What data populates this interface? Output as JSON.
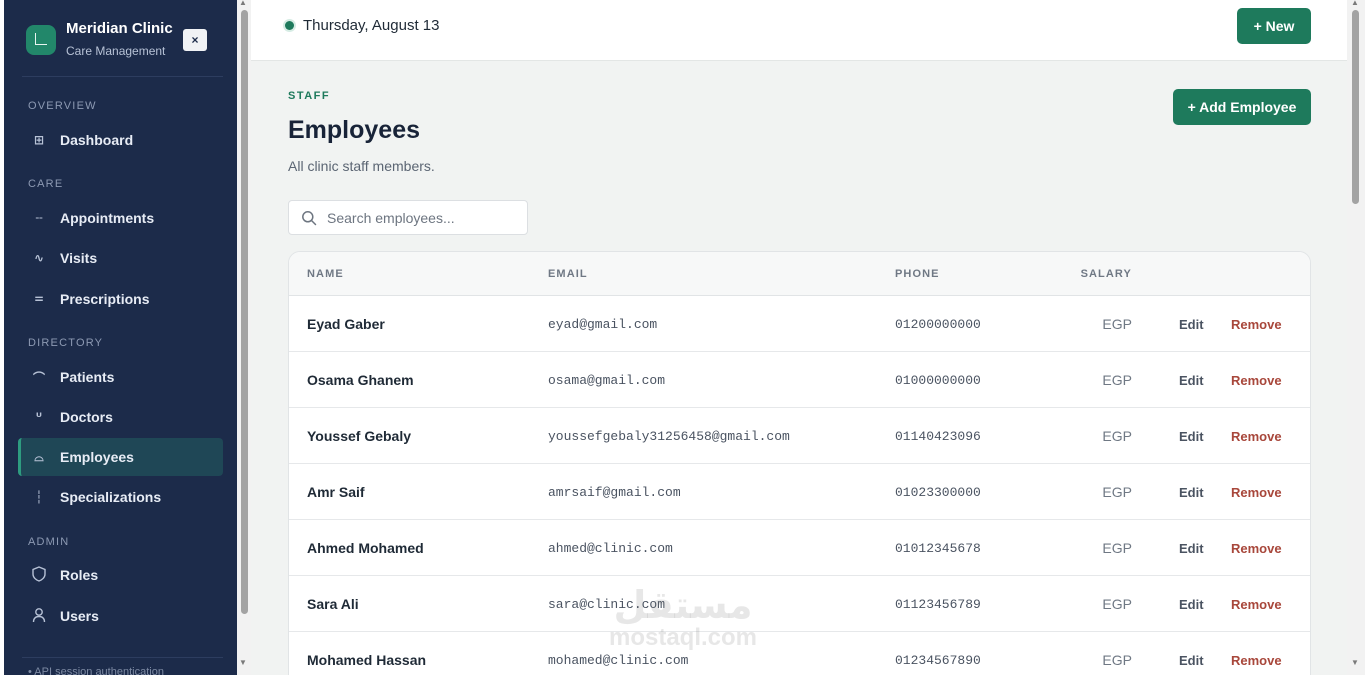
{
  "sidebar": {
    "brand_title": "Meridian Clinic",
    "brand_subtitle": "Care Management",
    "close_label": "×",
    "sections": {
      "overview": "OVERVIEW",
      "care": "CARE",
      "directory": "DIRECTORY",
      "admin": "ADMIN"
    },
    "items": {
      "dashboard": {
        "label": "Dashboard",
        "icon": "⊞"
      },
      "appointments": {
        "label": "Appointments",
        "icon": "╌"
      },
      "visits": {
        "label": "Visits",
        "icon": "∿"
      },
      "prescriptions": {
        "label": "Prescriptions",
        "icon": "="
      },
      "patients": {
        "label": "Patients",
        "icon": "⌒"
      },
      "doctors": {
        "label": "Doctors",
        "icon": "ᵁ"
      },
      "employees": {
        "label": "Employees",
        "icon": "⌓"
      },
      "specializations": {
        "label": "Specializations",
        "icon": "┆"
      },
      "roles": {
        "label": "Roles",
        "icon": "shield-icon"
      },
      "users": {
        "label": "Users",
        "icon": "user-icon"
      }
    },
    "footer_text": "• API session authentication"
  },
  "topbar": {
    "date": "Thursday, August 13",
    "new_button": "+ New"
  },
  "page": {
    "eyebrow": "STAFF",
    "title": "Employees",
    "subtitle": "All clinic staff members.",
    "add_button": "+ Add Employee",
    "search_placeholder": "Search employees..."
  },
  "table": {
    "columns": {
      "name": "NAME",
      "email": "EMAIL",
      "phone": "PHONE",
      "salary": "SALARY"
    },
    "edit_label": "Edit",
    "remove_label": "Remove",
    "rows": [
      {
        "name": "Eyad Gaber",
        "email": "eyad@gmail.com",
        "phone": "01200000000",
        "salary": "EGP"
      },
      {
        "name": "Osama Ghanem",
        "email": "osama@gmail.com",
        "phone": "01000000000",
        "salary": "EGP"
      },
      {
        "name": "Youssef Gebaly",
        "email": "youssefgebaly31256458@gmail.com",
        "phone": "01140423096",
        "salary": "EGP"
      },
      {
        "name": "Amr Saif",
        "email": "amrsaif@gmail.com",
        "phone": "01023300000",
        "salary": "EGP"
      },
      {
        "name": "Ahmed Mohamed",
        "email": "ahmed@clinic.com",
        "phone": "01012345678",
        "salary": "EGP"
      },
      {
        "name": "Sara Ali",
        "email": "sara@clinic.com",
        "phone": "01123456789",
        "salary": "EGP"
      },
      {
        "name": "Mohamed Hassan",
        "email": "mohamed@clinic.com",
        "phone": "01234567890",
        "salary": "EGP"
      }
    ]
  },
  "watermark": {
    "arabic": "مستقل",
    "latin": "mostaql.com"
  },
  "colors": {
    "sidebar_bg": "#1c2b4a",
    "accent": "#1e7a5c",
    "danger": "#a8473b",
    "main_bg": "#f1f3f2"
  }
}
